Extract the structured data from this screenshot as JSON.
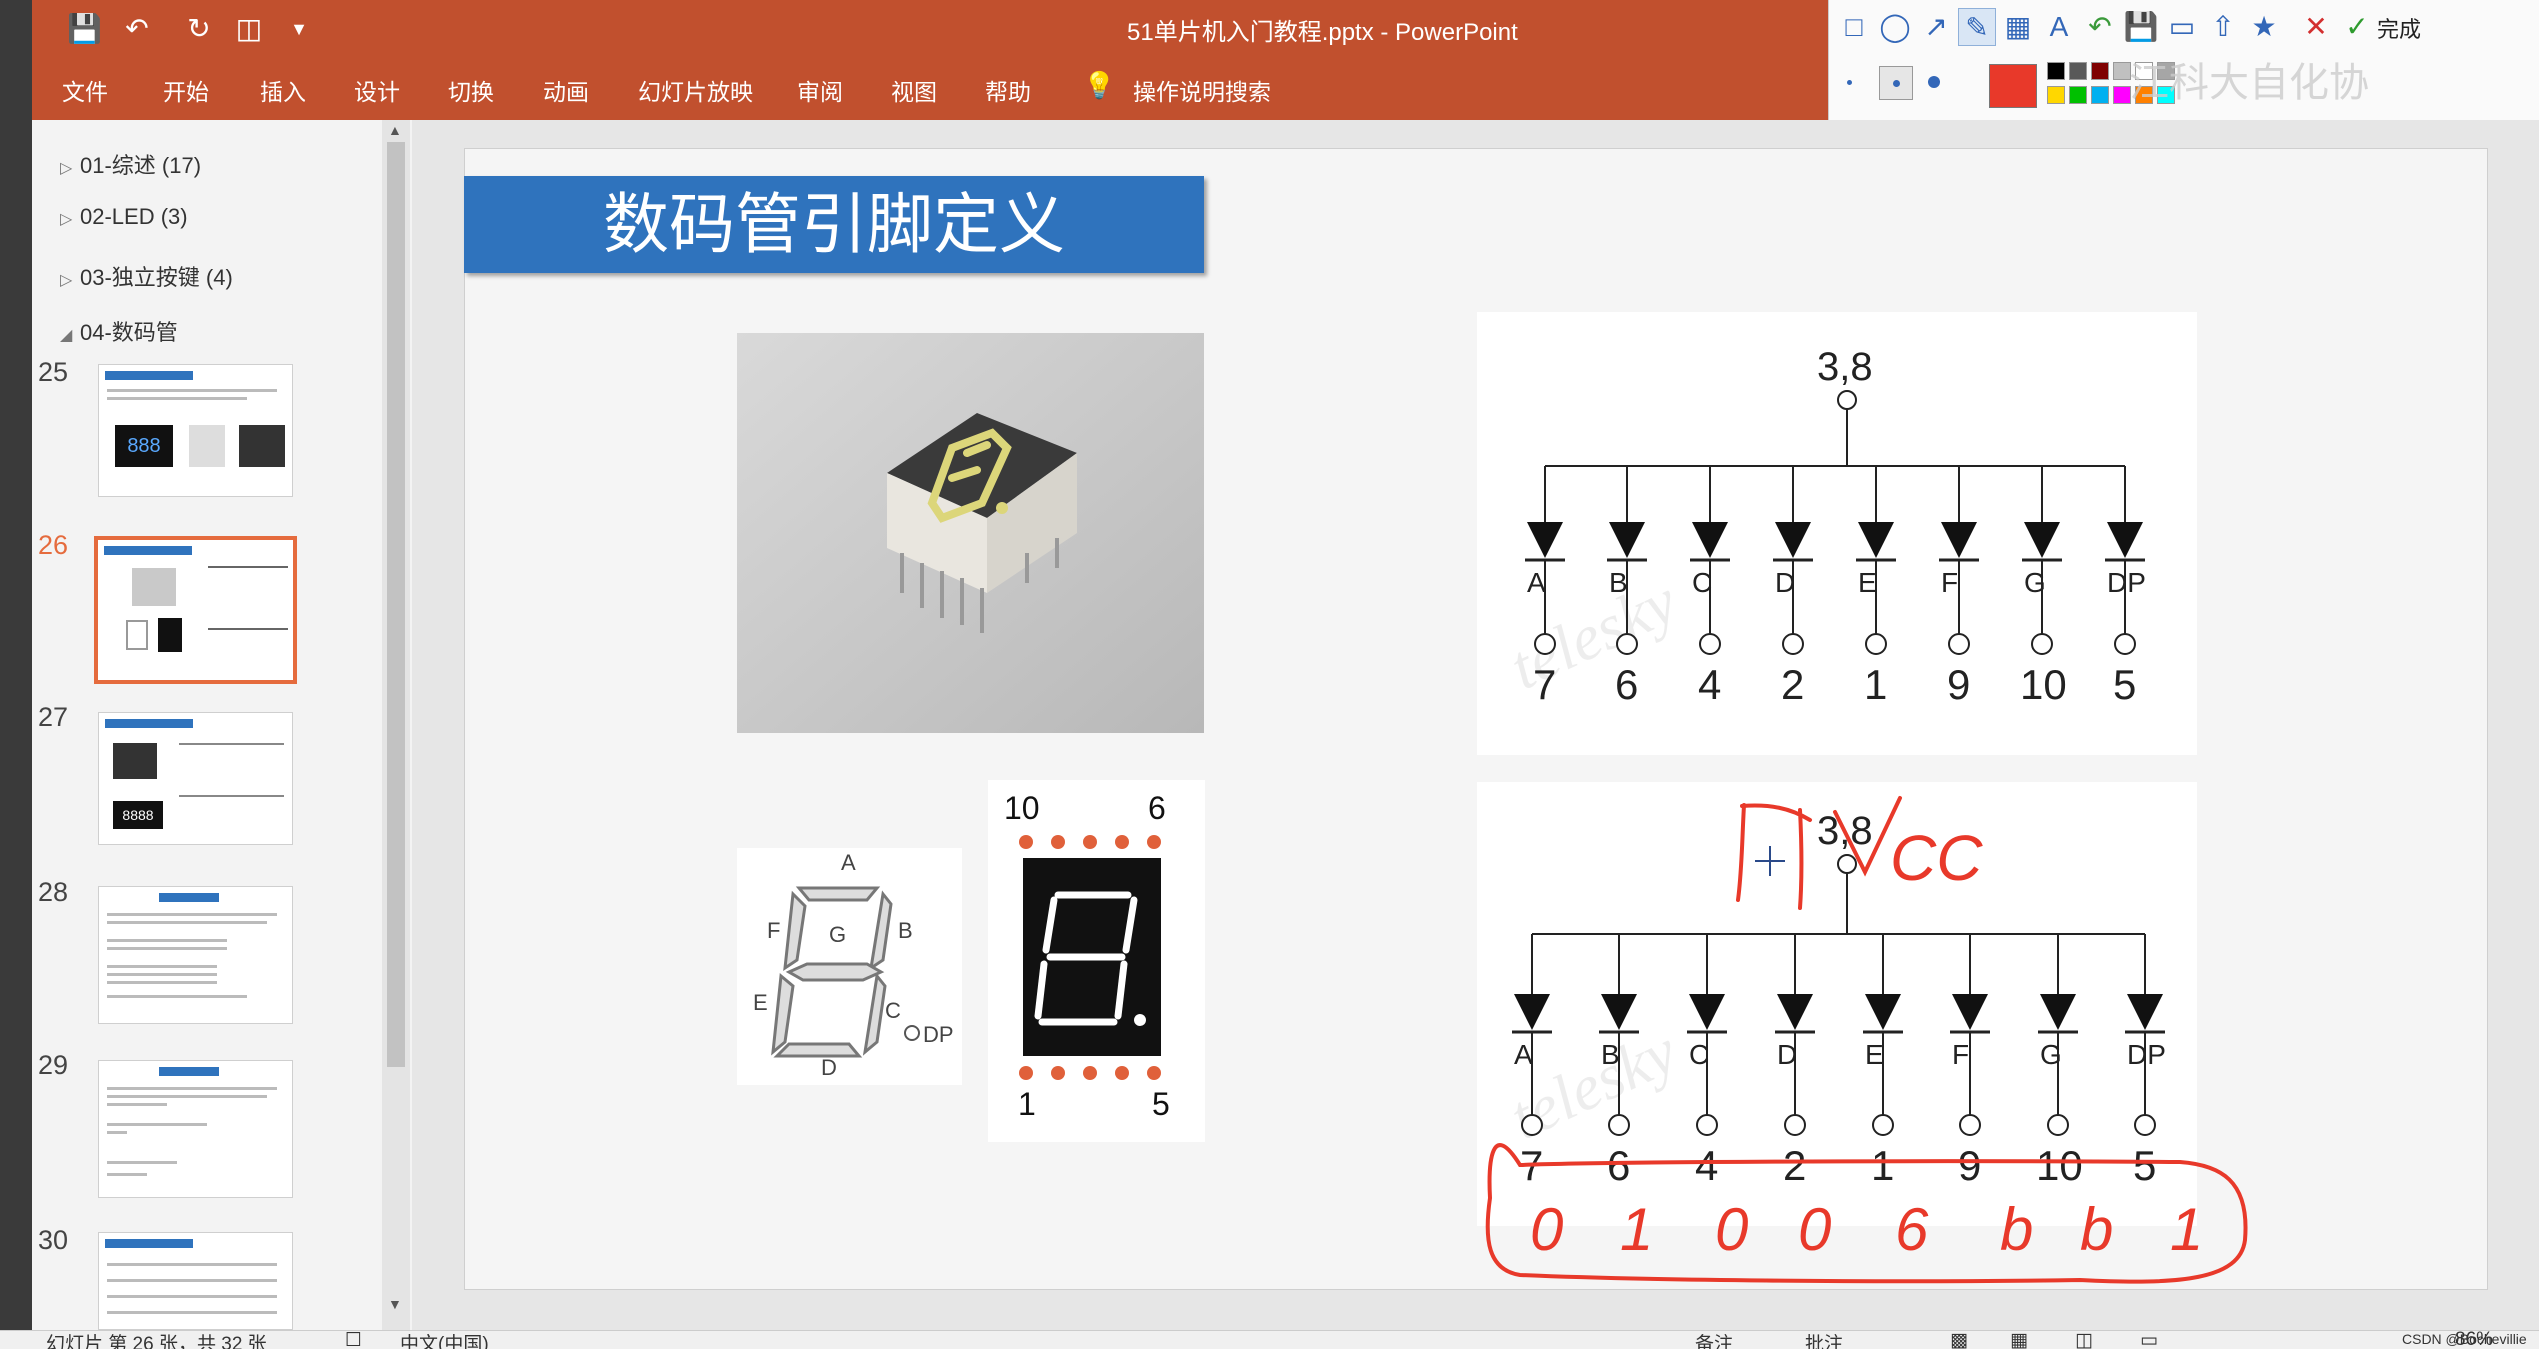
{
  "window": {
    "title": "51单片机入门教程.pptx  -  PowerPoint"
  },
  "quick_access": {
    "icons": [
      "save-icon",
      "undo-icon",
      "redo-icon",
      "present-icon",
      "customize-icon"
    ]
  },
  "ribbon": {
    "tabs": [
      "文件",
      "开始",
      "插入",
      "设计",
      "切换",
      "动画",
      "幻灯片放映",
      "审阅",
      "视图",
      "帮助"
    ],
    "tell_me": "操作说明搜索"
  },
  "palette": {
    "done_label": "完成",
    "overlay_text": "江科大自化协",
    "colors": {
      "current": "#e8392a",
      "grid": [
        "#000000",
        "#595959",
        "#7f0000",
        "#c0c0c0",
        "#ffffff",
        "#a6a6a6",
        "#ffd700",
        "#00c000",
        "#00b0f0",
        "#ff00ff",
        "#ff8000",
        "#00ffff"
      ]
    }
  },
  "sidebar": {
    "sections": [
      {
        "label": "01-综述 (17)",
        "expanded": false
      },
      {
        "label": "02-LED (3)",
        "expanded": false
      },
      {
        "label": "03-独立按键 (4)",
        "expanded": false
      },
      {
        "label": "04-数码管",
        "expanded": true
      }
    ],
    "slides": [
      {
        "number": "25",
        "selected": false
      },
      {
        "number": "26",
        "selected": true
      },
      {
        "number": "27",
        "selected": false
      },
      {
        "number": "28",
        "selected": false
      },
      {
        "number": "29",
        "selected": false
      },
      {
        "number": "30",
        "selected": false
      }
    ]
  },
  "slide": {
    "title": "数码管引脚定义",
    "common_pin_label": "3,8",
    "segments": [
      "A",
      "B",
      "C",
      "D",
      "E",
      "F",
      "G",
      "DP"
    ],
    "pins": [
      "7",
      "6",
      "4",
      "2",
      "1",
      "9",
      "10",
      "5"
    ],
    "module_pins": {
      "top_left": "10",
      "top_right": "6",
      "bottom_left": "1",
      "bottom_right": "5"
    },
    "segment_diagram_labels": [
      "A",
      "B",
      "C",
      "D",
      "E",
      "F",
      "G",
      "DP"
    ],
    "watermark": "telesky",
    "annotation": {
      "vcc_text": "VCC",
      "handwritten_digits": [
        "0",
        "1",
        "0",
        "0",
        "6",
        "b",
        "b",
        "1"
      ],
      "color": "#e8392a"
    }
  },
  "statusbar": {
    "slide_info": "幻灯片 第 26 张，共 32 张",
    "language": "中文(中国)",
    "notes": "备注",
    "comments": "批注",
    "zoom": "86%",
    "credit": "CSDN @Bochevillie"
  }
}
